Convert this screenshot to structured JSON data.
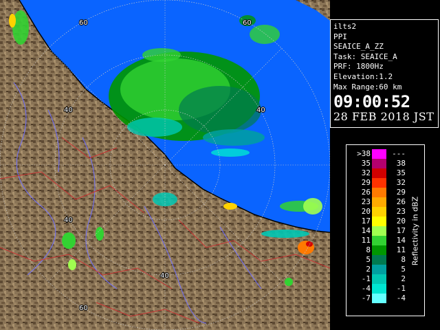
{
  "info": {
    "station": "ilts2",
    "scan_type": "PPI",
    "product": "SEAICE_A_ZZ",
    "task": "Task: SEAICE_A",
    "prf": "PRF: 1800Hz",
    "elevation": "Elevation:1.2",
    "max_range": "Max Range:60 km",
    "time": "09:00:52",
    "date": "28 FEB 2018 JST"
  },
  "rings": {
    "labels": [
      "40",
      "40",
      "40",
      "40",
      "60",
      "60",
      "60"
    ]
  },
  "legend": {
    "title": "Reflectivity in dBZ",
    "rows": [
      {
        "low": ">38",
        "high": "---",
        "color": "#ff00ff"
      },
      {
        "low": "35",
        "high": "38",
        "color": "#b4006e"
      },
      {
        "low": "32",
        "high": "35",
        "color": "#d20000"
      },
      {
        "low": "29",
        "high": "32",
        "color": "#ff3200"
      },
      {
        "low": "26",
        "high": "29",
        "color": "#ff7a00"
      },
      {
        "low": "23",
        "high": "26",
        "color": "#ffaa00"
      },
      {
        "low": "20",
        "high": "23",
        "color": "#ffd200"
      },
      {
        "low": "17",
        "high": "20",
        "color": "#ffff00"
      },
      {
        "low": "14",
        "high": "17",
        "color": "#a0ff50"
      },
      {
        "low": "11",
        "high": "14",
        "color": "#32d232"
      },
      {
        "low": "8",
        "high": "11",
        "color": "#009600"
      },
      {
        "low": "5",
        "high": "8",
        "color": "#007a50"
      },
      {
        "low": "2",
        "high": "5",
        "color": "#00a0a0"
      },
      {
        "low": "-1",
        "high": "2",
        "color": "#00c8b4"
      },
      {
        "low": "-4",
        "high": "-1",
        "color": "#00e6d2"
      },
      {
        "low": "-7",
        "high": "-4",
        "color": "#64ffff"
      }
    ]
  },
  "colors": {
    "sea": "#0a64ff",
    "land": "#8a7456",
    "coastline": "#000000",
    "ring": "#c8c8c8"
  }
}
